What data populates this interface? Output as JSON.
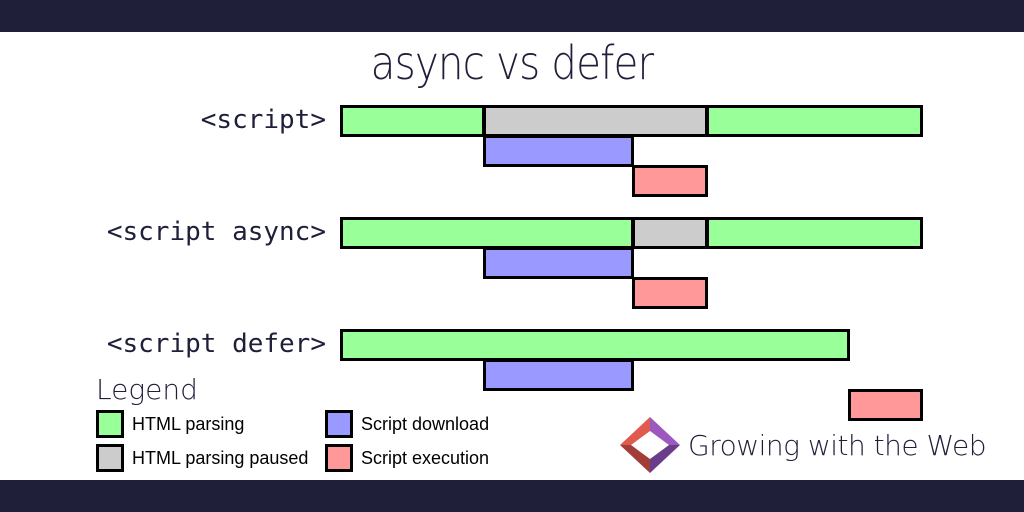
{
  "title": "async vs defer",
  "colors": {
    "html_parsing": "#99ff99",
    "html_parsing_paused": "#cccccc",
    "script_download": "#9999ff",
    "script_execution": "#ff9999",
    "band": "#1f1f3a"
  },
  "timeline": {
    "time_range": [
      0,
      100
    ],
    "rows": [
      {
        "label": "<script>",
        "segments": [
          {
            "track": 0,
            "type": "html_parsing",
            "start": 0,
            "end": 24.6
          },
          {
            "track": 0,
            "type": "html_parsing_paused",
            "start": 24.6,
            "end": 63.0
          },
          {
            "track": 0,
            "type": "html_parsing",
            "start": 63.0,
            "end": 100
          },
          {
            "track": 1,
            "type": "script_download",
            "start": 24.6,
            "end": 50.3
          },
          {
            "track": 2,
            "type": "script_execution",
            "start": 50.3,
            "end": 63.0
          }
        ]
      },
      {
        "label": "<script async>",
        "segments": [
          {
            "track": 0,
            "type": "html_parsing",
            "start": 0,
            "end": 50.3
          },
          {
            "track": 0,
            "type": "html_parsing_paused",
            "start": 50.3,
            "end": 63.0
          },
          {
            "track": 0,
            "type": "html_parsing",
            "start": 63.0,
            "end": 100
          },
          {
            "track": 1,
            "type": "script_download",
            "start": 24.6,
            "end": 50.3
          },
          {
            "track": 2,
            "type": "script_execution",
            "start": 50.3,
            "end": 63.0
          }
        ]
      },
      {
        "label": "<script defer>",
        "segments": [
          {
            "track": 0,
            "type": "html_parsing",
            "start": 0,
            "end": 87.4
          },
          {
            "track": 1,
            "type": "script_download",
            "start": 24.6,
            "end": 50.3
          },
          {
            "track": 2,
            "type": "script_execution",
            "start": 87.4,
            "end": 100
          }
        ]
      }
    ]
  },
  "legend": {
    "title": "Legend",
    "items": [
      {
        "type": "html_parsing",
        "label": "HTML parsing"
      },
      {
        "type": "html_parsing_paused",
        "label": "HTML parsing paused"
      },
      {
        "type": "script_download",
        "label": "Script download"
      },
      {
        "type": "script_execution",
        "label": "Script execution"
      }
    ]
  },
  "brand": {
    "name": "Growing with the Web",
    "logo_icon": "diamond-logo-icon"
  }
}
